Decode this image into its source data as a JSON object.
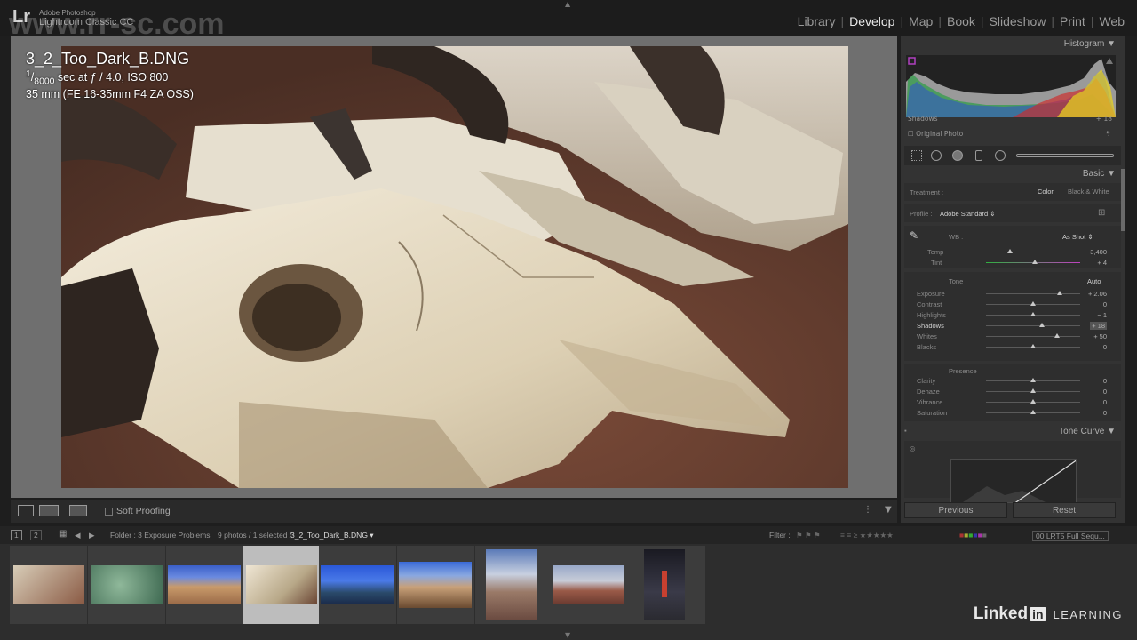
{
  "app": {
    "logo": "Lr",
    "vendor": "Adobe Photoshop",
    "name": "Lightroom Classic CC",
    "watermark_url": "www.rr-sc.com"
  },
  "modules": [
    "Library",
    "Develop",
    "Map",
    "Book",
    "Slideshow",
    "Print",
    "Web"
  ],
  "active_module": "Develop",
  "photo": {
    "filename": "3_2_Too_Dark_B.DNG",
    "shutter_num": "1",
    "shutter_den": "8000",
    "exposure_rest": " sec at ƒ / 4.0, ISO 800",
    "lens": "35 mm (FE 16-35mm F4 ZA OSS)"
  },
  "toolbar": {
    "soft_proofing": "Soft Proofing"
  },
  "panel": {
    "histogram_title": "Histogram",
    "shadows_label": "Shadows",
    "shadows_value": "+ 18",
    "original_photo": "Original Photo",
    "basic_title": "Basic",
    "treatment_label": "Treatment :",
    "treatment_color": "Color",
    "treatment_bw": "Black & White",
    "profile_label": "Profile :",
    "profile_value": "Adobe Standard",
    "wb_label": "WB :",
    "wb_value": "As Shot",
    "temp_label": "Temp",
    "temp_value": "3,400",
    "tint_label": "Tint",
    "tint_value": "+ 4",
    "tone_label": "Tone",
    "auto_label": "Auto",
    "sliders": [
      {
        "label": "Exposure",
        "value": "+ 2.06",
        "pos": 0.78
      },
      {
        "label": "Contrast",
        "value": "0",
        "pos": 0.5
      },
      {
        "label": "Highlights",
        "value": "− 1",
        "pos": 0.5
      },
      {
        "label": "Shadows",
        "value": "+ 18",
        "pos": 0.59
      },
      {
        "label": "Whites",
        "value": "+ 50",
        "pos": 0.75
      },
      {
        "label": "Blacks",
        "value": "0",
        "pos": 0.5
      }
    ],
    "presence_label": "Presence",
    "presence_sliders": [
      {
        "label": "Clarity",
        "value": "0",
        "pos": 0.5
      },
      {
        "label": "Dehaze",
        "value": "0",
        "pos": 0.5
      },
      {
        "label": "Vibrance",
        "value": "0",
        "pos": 0.5
      },
      {
        "label": "Saturation",
        "value": "0",
        "pos": 0.5
      }
    ],
    "temp_pos": 0.25,
    "tint_pos": 0.52,
    "tone_curve_title": "Tone Curve",
    "previous_button": "Previous",
    "reset_button": "Reset"
  },
  "filmbar": {
    "page1": "1",
    "page2": "2",
    "folder": "Folder : 3 Exposure Problems",
    "count": "9 photos / 1 selected /",
    "selected_file": "3_2_Too_Dark_B.DNG",
    "filter_label": "Filter :",
    "collection": "00 LRT5 Full Sequ..."
  },
  "filmstrip_count": 9,
  "filmstrip_selected_index": 3,
  "branding": {
    "word": "Linked",
    "in": "in",
    "learning": "LEARNING"
  }
}
